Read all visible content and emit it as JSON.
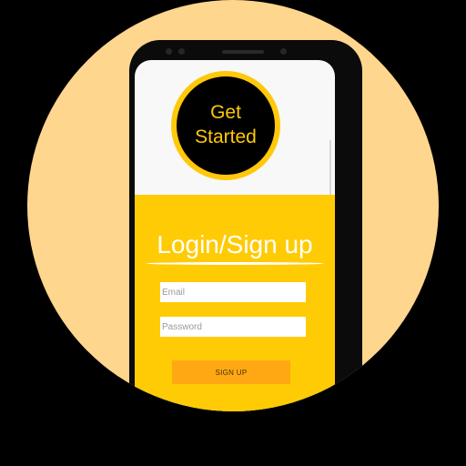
{
  "colors": {
    "background": "#000000",
    "circle": "#FFD68E",
    "accent": "#FFCB05",
    "get_started_ring": "#FFC80A",
    "button": "#FFA814",
    "title_text": "#FFFFFF"
  },
  "hero": {
    "get_started_label": "Get\nStarted"
  },
  "form": {
    "title": "Login/Sign up",
    "email_placeholder": "Email",
    "password_placeholder": "Password",
    "signup_label": "SIGN UP"
  },
  "icons": {
    "speaker": "speaker-grille",
    "camera": "front-camera",
    "sensor": "proximity-sensor"
  }
}
